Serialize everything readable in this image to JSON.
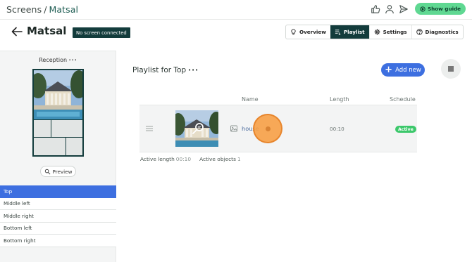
{
  "breadcrumb": {
    "root": "Screens",
    "separator": "/",
    "current": "Matsal"
  },
  "topbar": {
    "icons": [
      "thumbs-up-icon",
      "user-icon",
      "send-icon"
    ],
    "guide_button": "Show guide"
  },
  "header": {
    "title": "Matsal",
    "status_badge": "No screen connected",
    "tabs": [
      {
        "label": "Overview",
        "icon": "lightbulb-icon",
        "active": false
      },
      {
        "label": "Playlist",
        "icon": "playlist-icon",
        "active": true
      },
      {
        "label": "Settings",
        "icon": "gear-icon",
        "active": false
      },
      {
        "label": "Diagnostics",
        "icon": "help-circle-icon",
        "active": false
      }
    ]
  },
  "sidebar": {
    "layout_name": "Reception",
    "layout_menu": "···",
    "preview_button": "Preview",
    "zones": [
      {
        "label": "Top",
        "active": true
      },
      {
        "label": "Middle left",
        "active": false
      },
      {
        "label": "Middle right",
        "active": false
      },
      {
        "label": "Bottom left",
        "active": false
      },
      {
        "label": "Bottom right",
        "active": false
      }
    ]
  },
  "playlist": {
    "title": "Playlist for Top",
    "title_menu": "···",
    "add_button": "Add new",
    "columns": {
      "name": "Name",
      "length": "Length",
      "schedule": "Schedule"
    },
    "items": [
      {
        "name": "house",
        "length": "00:10",
        "schedule": "Active",
        "type": "image-icon"
      }
    ],
    "stats": {
      "active_length_label": "Active length",
      "active_length_value": "00:10",
      "active_objects_label": "Active objects",
      "active_objects_value": "1"
    }
  },
  "colors": {
    "brand_dark": "#133c3c",
    "accent_blue": "#3d6fe0",
    "guide_green": "#5fd892",
    "status_active": "#3cc86b"
  }
}
